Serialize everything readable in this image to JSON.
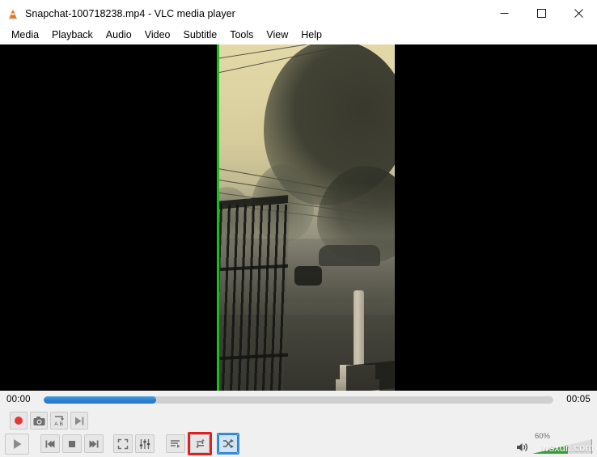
{
  "window": {
    "title": "Snapchat-100718238.mp4 - VLC media player",
    "app_icon": "vlc-cone-icon",
    "controls": {
      "minimize": "minimize-icon",
      "maximize": "maximize-icon",
      "close": "close-icon"
    }
  },
  "menubar": {
    "items": [
      {
        "label": "Media"
      },
      {
        "label": "Playback"
      },
      {
        "label": "Audio"
      },
      {
        "label": "Video"
      },
      {
        "label": "Subtitle"
      },
      {
        "label": "Tools"
      },
      {
        "label": "View"
      },
      {
        "label": "Help"
      }
    ]
  },
  "video": {
    "description": "Foggy street scene with trees, power lines and metal fence, sepia sky",
    "pillarbox_color": "#000000",
    "edge_marker_color": "#18bf18"
  },
  "seek": {
    "elapsed": "00:00",
    "total": "00:05",
    "progress_percent": 22,
    "fill_color": "#2a7fd0",
    "track_color": "#cfcfcf"
  },
  "advanced_controls": {
    "buttons": [
      {
        "name": "record-button",
        "icon": "record-icon",
        "label": "Record"
      },
      {
        "name": "snapshot-button",
        "icon": "camera-icon",
        "label": "Take Snapshot"
      },
      {
        "name": "ab-loop-button",
        "icon": "ab-loop-icon",
        "label": "Loop from point A to point B"
      },
      {
        "name": "frame-by-frame-button",
        "icon": "frame-step-icon",
        "label": "Frame by frame"
      }
    ]
  },
  "playback_controls": {
    "play": {
      "icon": "play-icon",
      "label": "Play"
    },
    "previous": {
      "icon": "previous-icon",
      "label": "Previous"
    },
    "stop": {
      "icon": "stop-icon",
      "label": "Stop"
    },
    "next": {
      "icon": "next-icon",
      "label": "Next"
    },
    "fullscreen": {
      "icon": "fullscreen-icon",
      "label": "Toggle fullscreen"
    },
    "settings": {
      "icon": "equalizer-icon",
      "label": "Show extended settings"
    },
    "playlist": {
      "icon": "playlist-icon",
      "label": "Show playlist"
    },
    "loop": {
      "icon": "loop-icon",
      "label": "Click to toggle between loop all, loop one and no loop",
      "highlight_color": "#e02020",
      "highlighted": true
    },
    "shuffle": {
      "icon": "shuffle-icon",
      "label": "Random",
      "selected": true,
      "selected_color": "#cfe4f5",
      "border_color": "#2a7fd0"
    }
  },
  "volume": {
    "percent_label": "60%",
    "level": 60,
    "icon": "speaker-icon",
    "fill_color": "#3d9c3d"
  },
  "watermark": {
    "text": "wsxdn.com"
  }
}
